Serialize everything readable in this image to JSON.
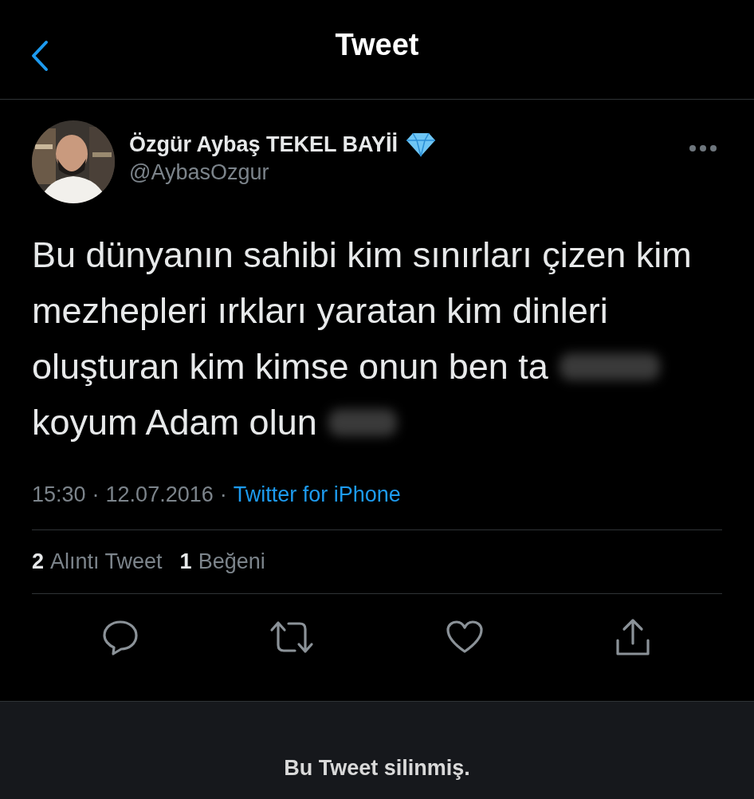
{
  "nav": {
    "title": "Tweet"
  },
  "author": {
    "name": "Özgür Aybaş TEKEL BAYİİ",
    "handle": "@AybasOzgur"
  },
  "body": [
    {
      "text": "Bu dünyanın sahibi kim sınırları çizen kim",
      "redacted": false
    },
    {
      "text": "mezhepleri ırkları yaratan kim dinleri",
      "redacted": false
    },
    {
      "text": "oluşturan kim kimse onun ben ta",
      "redacted": true
    },
    {
      "text": "koyum Adam olun",
      "redacted": true
    }
  ],
  "meta": {
    "time": "15:30",
    "separator_1": "·",
    "date": "12.07.2016",
    "separator_2": "·",
    "source": "Twitter for iPhone"
  },
  "stats": [
    {
      "count": "2",
      "label": "Alıntı Tweet"
    },
    {
      "count": "1",
      "label": "Beğeni"
    }
  ],
  "notice": "Bu Tweet silinmiş."
}
